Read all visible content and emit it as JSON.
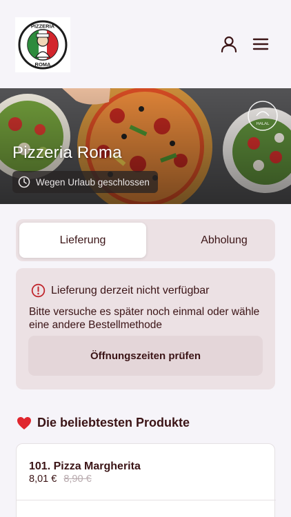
{
  "header": {
    "logo": {
      "top_text": "PIZZERIA",
      "bottom_text": "ROMA",
      "icon": "pizzeria-roma-logo"
    },
    "user_icon": "user-icon",
    "menu_icon": "hamburger-menu-icon"
  },
  "hero": {
    "title": "Pizzeria Roma",
    "status_icon": "clock-icon",
    "status": "Wegen Urlaub geschlossen",
    "halal_badge": "HALAL"
  },
  "order_mode": {
    "tabs": [
      {
        "label": "Lieferung",
        "active": true
      },
      {
        "label": "Abholung",
        "active": false
      }
    ]
  },
  "notice": {
    "icon": "info-icon",
    "title": "Lieferung derzeit nicht verfügbar",
    "body": "Bitte versuche es später noch einmal oder wähle eine andere Bestellmethode",
    "button_label": "Öffnungszeiten prüfen"
  },
  "popular": {
    "icon": "heart-icon",
    "title": "Die beliebtesten Produkte",
    "products": [
      {
        "name": "101. Pizza Margherita",
        "price": "8,01 €",
        "old_price": "8,90 €"
      }
    ]
  },
  "colors": {
    "brand_text": "#3b1416",
    "panel_bg": "#ece1e4",
    "page_bg": "#f6f4f9",
    "alert_red": "#c0262d"
  }
}
